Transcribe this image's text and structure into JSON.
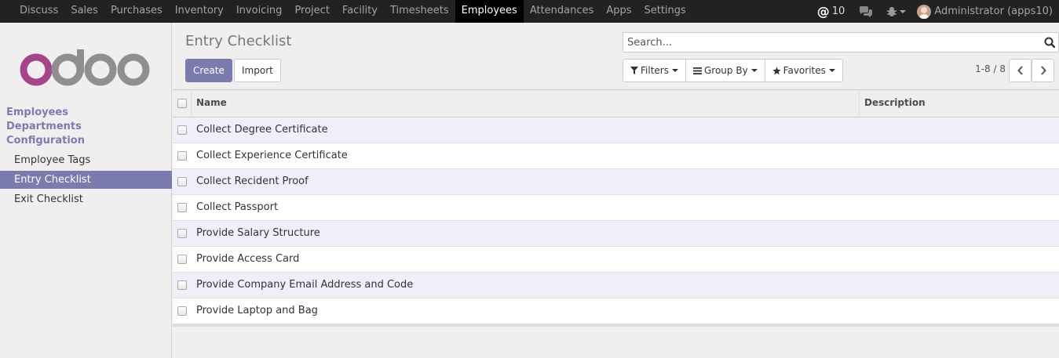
{
  "topbar": {
    "menu": [
      "Discuss",
      "Sales",
      "Purchases",
      "Inventory",
      "Invoicing",
      "Project",
      "Facility",
      "Timesheets",
      "Employees",
      "Attendances",
      "Apps",
      "Settings"
    ],
    "active_menu": "Employees",
    "mention_count": "10",
    "user_label": "Administrator (apps10)"
  },
  "sidebar": {
    "sections": [
      "Employees",
      "Departments",
      "Configuration"
    ],
    "links": [
      "Employee Tags",
      "Entry Checklist",
      "Exit Checklist"
    ],
    "active_link": "Entry Checklist"
  },
  "control_panel": {
    "title": "Entry Checklist",
    "create_label": "Create",
    "import_label": "Import",
    "search_placeholder": "Search...",
    "filters_label": "Filters",
    "groupby_label": "Group By",
    "favorites_label": "Favorites",
    "pager_value": "1-8 / 8"
  },
  "table": {
    "columns": [
      "Name",
      "Description"
    ],
    "rows": [
      {
        "name": "Collect Degree Certificate",
        "description": ""
      },
      {
        "name": "Collect Experience Certificate",
        "description": ""
      },
      {
        "name": "Collect Recident Proof",
        "description": ""
      },
      {
        "name": "Collect Passport",
        "description": ""
      },
      {
        "name": "Provide Salary Structure",
        "description": ""
      },
      {
        "name": "Provide Access Card",
        "description": ""
      },
      {
        "name": "Provide Company Email Address and Code",
        "description": ""
      },
      {
        "name": "Provide Laptop and Bag",
        "description": ""
      }
    ]
  },
  "colors": {
    "accent": "#7c7bad",
    "topbar_bg": "#222222",
    "logo_o1": "#a24689",
    "logo_gray": "#8f8f8f"
  }
}
